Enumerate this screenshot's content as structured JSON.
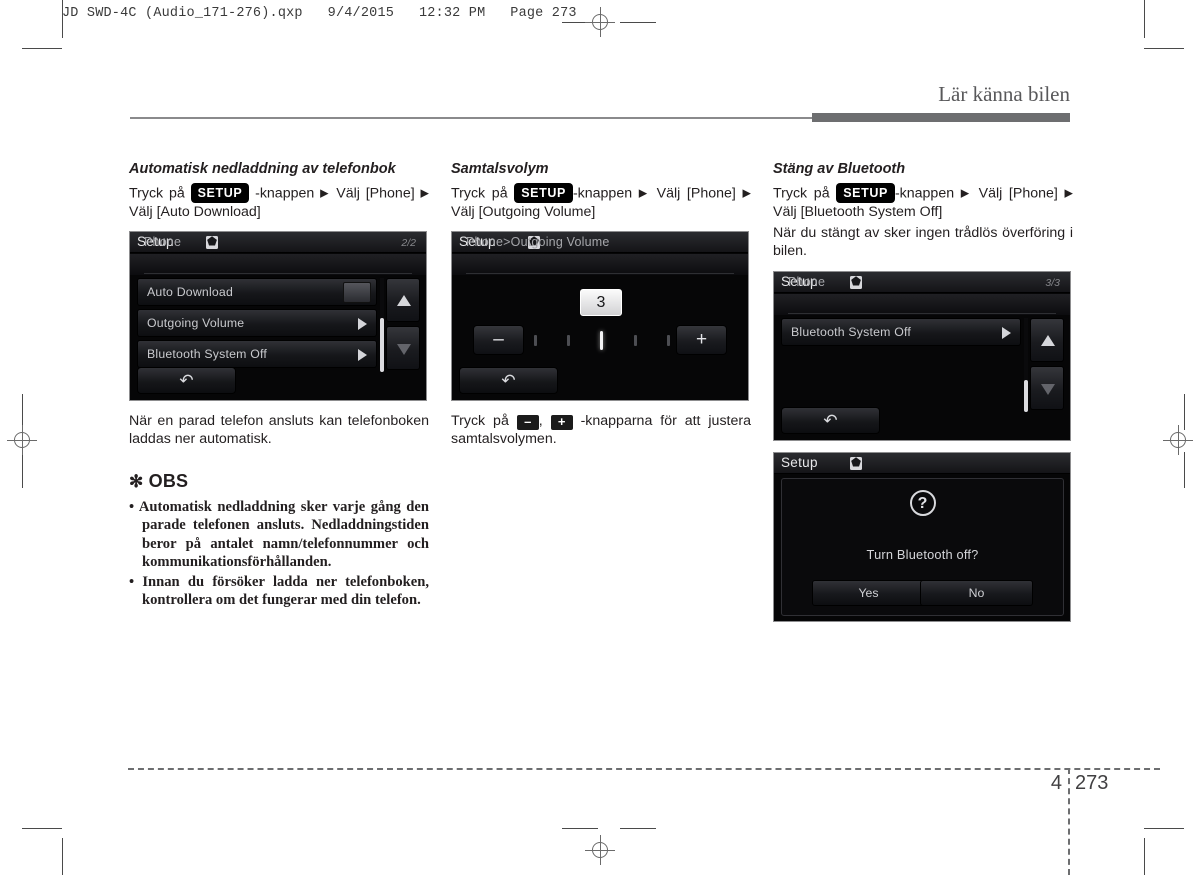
{
  "print_header": "JD SWD-4C (Audio_171-276).qxp   9/4/2015   12:32 PM   Page 273",
  "chapter_header": "Lär känna bilen",
  "footer": {
    "chapter_number": "4",
    "page_number": "273"
  },
  "columns": {
    "left": {
      "heading": "Automatisk nedladdning av telefonbok",
      "instruction_pre": "Tryck  på",
      "setup_key": "SETUP",
      "instruction_post": "-knappen",
      "instruction_select": "Välj [Phone]",
      "instruction_tail": "Välj [Auto Download]",
      "paragraph": "När  en  parad  telefon  ansluts  kan telefonboken laddas ner automatisk.",
      "note_title": "OBS",
      "note_star": "✻",
      "notes": [
        "Automatisk nedladdning sker varje gång den parade telefonen ansluts. Nedladdningstiden beror på antalet namn/telefonnummer och kommunikationsförhållanden.",
        "Innan du försöker ladda ner telefonboken, kontrollera om det fungerar med din telefon."
      ],
      "screen": {
        "title": "Setup",
        "bt_icon": "bluetooth-icon",
        "breadcrumb": "Phone",
        "page_indicator": "2/2",
        "rows": [
          {
            "label": "Auto Download",
            "control": "toggle"
          },
          {
            "label": "Outgoing Volume",
            "control": "caret"
          },
          {
            "label": "Bluetooth System Off",
            "control": "caret"
          }
        ],
        "back_icon": "back-arrow-icon",
        "scroll_up_icon": "triangle-up-icon",
        "scroll_down_icon": "triangle-down-icon"
      }
    },
    "middle": {
      "heading": "Samtalsvolym",
      "instruction_pre": "Tryck  på",
      "setup_key": "SETUP",
      "instruction_post": "-knappen",
      "instruction_select": "Välj [Phone]",
      "instruction_tail": "Välj [Outgoing Volume]",
      "caption_pre": "Tryck  på",
      "caption_minus": "–",
      "caption_comma": ",",
      "caption_plus": "+",
      "caption_post": "-knapparna  för  att justera samtalsvolymen.",
      "screen": {
        "title": "Setup",
        "bt_icon": "bluetooth-icon",
        "breadcrumb": "Phone>Outgoing Volume",
        "value": "3",
        "minus_label": "–",
        "plus_label": "+",
        "tick_count": 5,
        "tick_active_index": 2,
        "back_icon": "back-arrow-icon"
      }
    },
    "right": {
      "heading": "Stäng av Bluetooth",
      "instruction_pre": "Tryck   på",
      "setup_key": "SETUP",
      "instruction_post": "-knappen",
      "instruction_select": "Välj [Phone]",
      "instruction_tail": "Välj [Bluetooth System Off]",
      "paragraph": "När du stängt av sker ingen trådlös överföring i bilen.",
      "screen_list": {
        "title": "Setup",
        "bt_icon": "bluetooth-icon",
        "breadcrumb": "Phone",
        "page_indicator": "3/3",
        "rows": [
          {
            "label": "Bluetooth System Off",
            "control": "caret"
          }
        ],
        "back_icon": "back-arrow-icon",
        "scroll_up_icon": "triangle-up-icon",
        "scroll_down_icon": "triangle-down-icon"
      },
      "screen_dialog": {
        "title": "Setup",
        "bt_icon": "bluetooth-icon",
        "question_icon": "question-mark-icon",
        "message": "Turn Bluetooth off?",
        "yes_label": "Yes",
        "no_label": "No"
      }
    }
  },
  "colors": {
    "ink": "#231f20",
    "header_grey": "#6d6e70",
    "screen_black": "#060607"
  }
}
